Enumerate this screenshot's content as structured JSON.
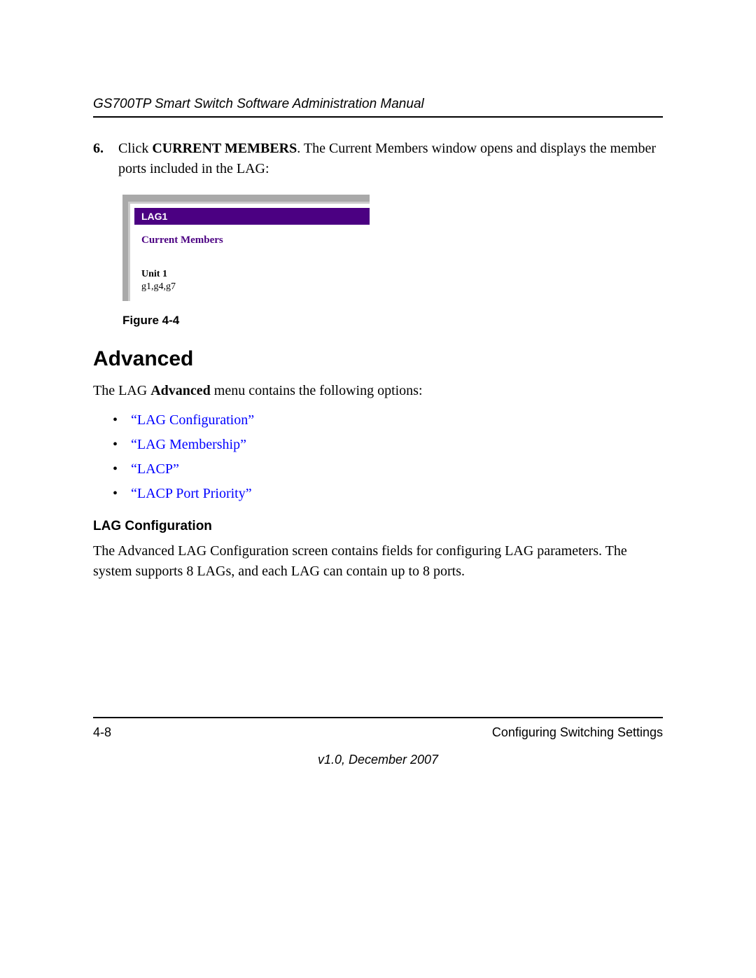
{
  "header": {
    "running_title": "GS700TP Smart Switch Software Administration Manual"
  },
  "step": {
    "number": "6.",
    "text_prefix": "Click ",
    "bold_term": "CURRENT MEMBERS",
    "text_suffix": ". The Current Members window opens and displays the member ports included in the LAG:"
  },
  "figure": {
    "titlebar": "LAG1",
    "subhead": "Current Members",
    "unit_label": "Unit 1",
    "ports": "g1,g4,g7",
    "caption": "Figure 4-4"
  },
  "section": {
    "heading": "Advanced",
    "intro_prefix": "The LAG ",
    "intro_bold": "Advanced",
    "intro_suffix": " menu contains the following options:"
  },
  "links": [
    "“LAG Configuration”",
    "“LAG Membership”",
    "“LACP”",
    "“LACP Port Priority”"
  ],
  "subsection": {
    "heading": "LAG Configuration",
    "body": "The Advanced LAG Configuration screen contains fields for configuring LAG parameters. The system supports 8 LAGs, and each LAG can contain up to 8 ports."
  },
  "footer": {
    "page_num": "4-8",
    "chapter": "Configuring Switching Settings",
    "version": "v1.0, December 2007"
  }
}
